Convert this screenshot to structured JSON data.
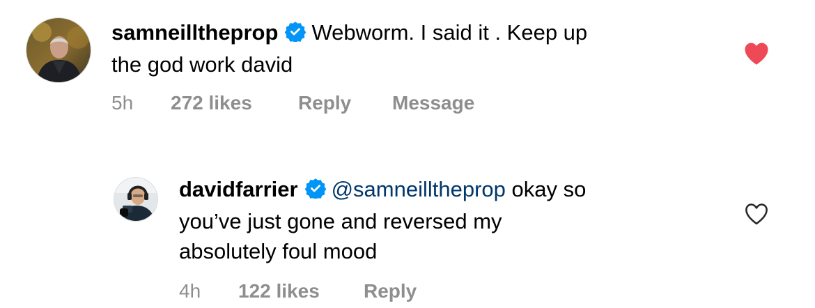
{
  "comments": [
    {
      "username": "samneilltheprop",
      "text": "Webworm. I said it . Keep up the god work david",
      "line1": "Webworm. I said it . Keep up",
      "line2": "the god work david",
      "time": "5h",
      "likes": "272 likes",
      "reply": "Reply",
      "message": "Message",
      "liked": true,
      "icon": "heart-filled-icon"
    },
    {
      "username": "davidfarrier",
      "mention": "@samneilltheprop",
      "text": "okay so you've just gone and reversed my absolutely foul mood",
      "line1": " okay so",
      "line2": "you’ve just gone and reversed my",
      "line3": "absolutely foul mood",
      "time": "4h",
      "likes": "122 likes",
      "reply": "Reply",
      "liked": false,
      "icon": "heart-outline-icon"
    }
  ],
  "colors": {
    "verified": "#0095f6",
    "like_red": "#ed4956",
    "meta_gray": "#8e8e8e",
    "mention_blue": "#00376b"
  }
}
